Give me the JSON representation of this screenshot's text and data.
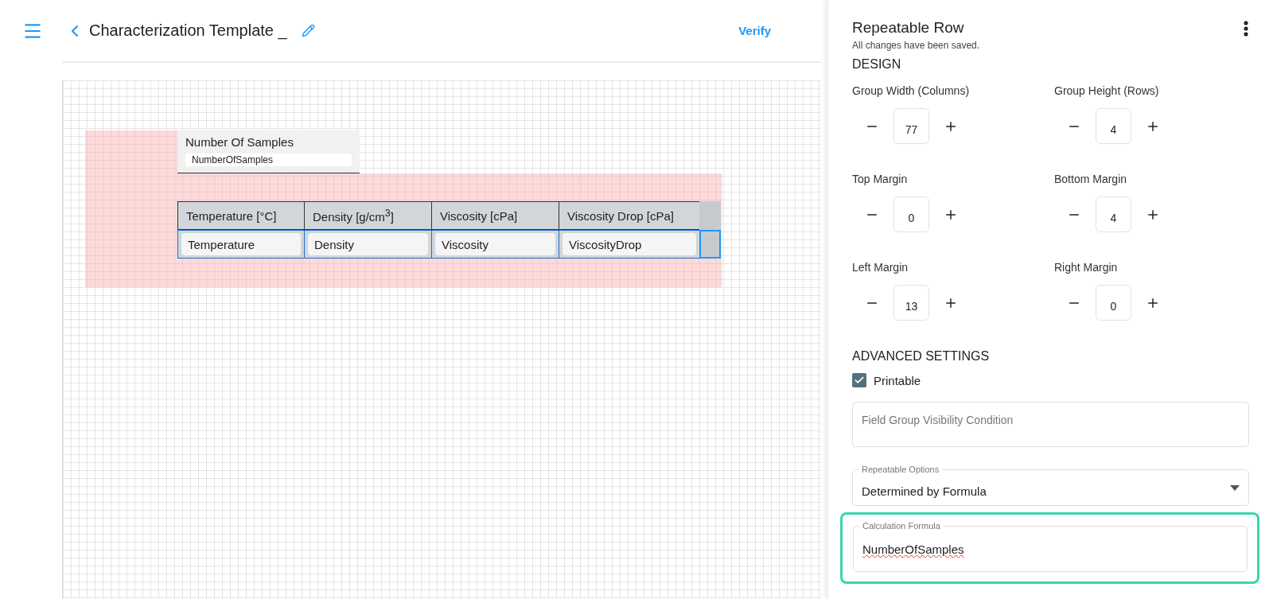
{
  "header": {
    "title": "Characterization Template _",
    "action": "Verify"
  },
  "canvas": {
    "header_field": {
      "label": "Number Of Samples",
      "value": "NumberOfSamples"
    },
    "table": {
      "columns": [
        "Temperature [°C]",
        "Density [g/cm$^{3}$]",
        "Viscosity [cPa]",
        "Viscosity Drop [cPa]"
      ],
      "row": {
        "selected": true,
        "cells": [
          "Temperature",
          "Density",
          "Viscosity",
          "ViscosityDrop"
        ]
      }
    }
  },
  "panel": {
    "title": "Repeatable Row",
    "status": "All changes have been saved.",
    "design_heading": "DESIGN",
    "steppers": [
      {
        "label": "Group Width (Columns)",
        "value": "77"
      },
      {
        "label": "Group Height (Rows)",
        "value": "4"
      },
      {
        "label": "Top Margin",
        "value": "0"
      },
      {
        "label": "Bottom Margin",
        "value": "4"
      },
      {
        "label": "Left Margin",
        "value": "13"
      },
      {
        "label": "Right Margin",
        "value": "0"
      }
    ],
    "advanced_heading": "ADVANCED SETTINGS",
    "printable": {
      "label": "Printable",
      "checked": true
    },
    "visibility_condition": {
      "placeholder": "Field Group Visibility Condition"
    },
    "repeatable_options": {
      "label": "Repeatable Options",
      "value": "Determined by Formula"
    },
    "calculation_formula": {
      "label": "Calculation Formula",
      "value": "NumberOfSamples",
      "highlighted": true
    }
  }
}
